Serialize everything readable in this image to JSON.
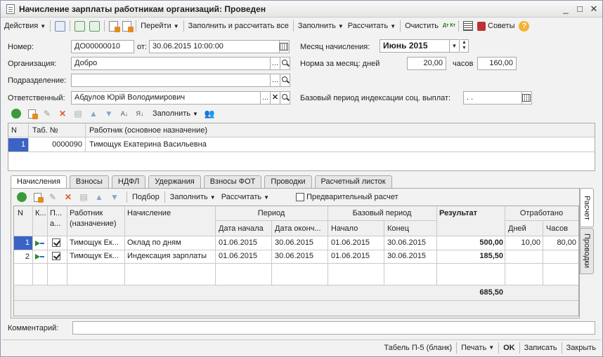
{
  "window": {
    "title": "Начисление зарплаты работникам организаций: Проведен"
  },
  "toolbar": {
    "actions_label": "Действия",
    "goto_label": "Перейти",
    "fill_and_calc_label": "Заполнить и рассчитать все",
    "fill_label": "Заполнить",
    "calculate_label": "Рассчитать",
    "clear_label": "Очистить",
    "tips_label": "Советы",
    "dt_kt_label": "Дт Кт"
  },
  "form": {
    "number_label": "Номер:",
    "number_value": "ДО00000010",
    "date_from_label": "от:",
    "date_value": "30.06.2015 10:00:00",
    "org_label": "Организация:",
    "org_value": "Добро",
    "subdivision_label": "Подразделение:",
    "subdivision_value": "",
    "responsible_label": "Ответственный:",
    "responsible_value": "Абдулов Юрій Володимирович",
    "month_label": "Месяц начисления:",
    "month_value": "Июнь 2015",
    "norm_label": "Норма за месяц: дней",
    "norm_days": "20,00",
    "hours_label": "часов",
    "norm_hours": "160,00",
    "base_period_label": "Базовый период индексации соц. выплат:",
    "base_period_value": ". ."
  },
  "workers_toolbar": {
    "fill_label": "Заполнить"
  },
  "workers_table": {
    "headers": {
      "n": "N",
      "tab_no": "Таб. №",
      "worker": "Работник (основное назначение)"
    },
    "rows": [
      {
        "n": "1",
        "tab_no": "0000090",
        "worker": "Тимощук Екатерина Васильевна"
      }
    ]
  },
  "tabs": [
    {
      "label": "Начисления",
      "active": true
    },
    {
      "label": "Взносы"
    },
    {
      "label": "НДФЛ"
    },
    {
      "label": "Удержания"
    },
    {
      "label": "Взносы ФОТ"
    },
    {
      "label": "Проводки"
    },
    {
      "label": "Расчетный листок"
    }
  ],
  "side_tabs": {
    "calc": "Расчет",
    "postings": "Проводки"
  },
  "accruals_toolbar": {
    "selection_label": "Подбор",
    "fill_label": "Заполнить",
    "calculate_label": "Рассчитать",
    "preliminary_label": "Предварительный расчет"
  },
  "accruals_table": {
    "headers": {
      "n": "N",
      "k": "К...",
      "p1": "П...",
      "p2": "а...",
      "worker1": "Работник",
      "worker2": "(назначение)",
      "accrual": "Начисление",
      "period": "Период",
      "period_start": "Дата начала",
      "period_end": "Дата оконч...",
      "base_period": "Базовый период",
      "base_start": "Начало",
      "base_end": "Конец",
      "result": "Результат",
      "worked": "Отработано",
      "days": "Дней",
      "hours": "Часов"
    },
    "rows": [
      {
        "n": "1",
        "worker": "Тимощук Ек...",
        "accrual": "Оклад по дням",
        "start": "01.06.2015",
        "end": "30.06.2015",
        "base_start": "01.06.2015",
        "base_end": "30.06.2015",
        "result": "500,00",
        "days": "10,00",
        "hours": "80,00"
      },
      {
        "n": "2",
        "worker": "Тимощук Ек...",
        "accrual": "Индексация зарплаты",
        "start": "01.06.2015",
        "end": "30.06.2015",
        "base_start": "01.06.2015",
        "base_end": "30.06.2015",
        "result": "185,50",
        "days": "",
        "hours": ""
      }
    ],
    "total": "685,50"
  },
  "comment": {
    "label": "Комментарий:",
    "value": ""
  },
  "status_bar": {
    "tabel_label": "Табель П-5 (бланк)",
    "print_label": "Печать",
    "ok_label": "OK",
    "save_label": "Записать",
    "close_label": "Закрыть"
  }
}
